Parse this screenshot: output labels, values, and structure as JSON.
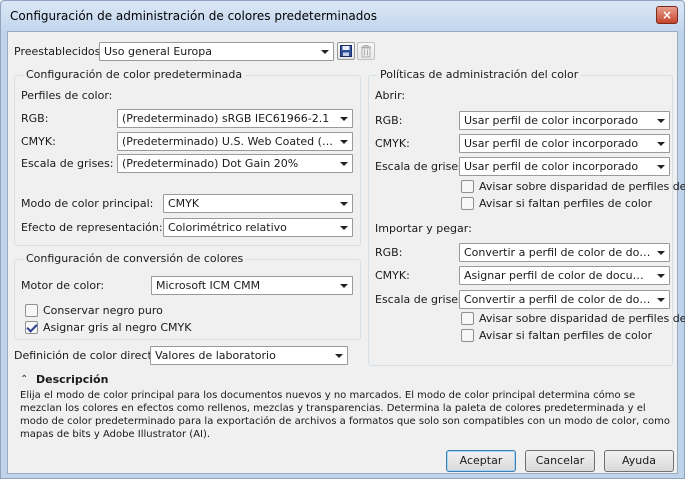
{
  "title": "Configuración de administración de colores predeterminados",
  "close_label": "×",
  "presets": {
    "label": "Preestablecidos:",
    "value": "Uso general Europa"
  },
  "default_settings": {
    "title": "Configuración de color predeterminada",
    "profiles_label": "Perfiles de color:",
    "rgb": {
      "label": "RGB:",
      "value": "(Predeterminado) sRGB IEC61966-2.1"
    },
    "cmyk": {
      "label": "CMYK:",
      "value": "(Predeterminado) U.S. Web Coated (SWOP)..."
    },
    "gray": {
      "label": "Escala de grises:",
      "value": "(Predeterminado) Dot Gain 20%"
    },
    "primary_mode": {
      "label": "Modo de color principal:",
      "value": "CMYK"
    },
    "rendering_intent": {
      "label": "Efecto de representación:",
      "value": "Colorimétrico relativo"
    }
  },
  "conversion": {
    "title": "Configuración de conversión de colores",
    "engine": {
      "label": "Motor de color:",
      "value": "Microsoft ICM CMM"
    },
    "preserve_black": {
      "label": "Conservar negro puro",
      "checked": false
    },
    "map_gray": {
      "label": "Asignar gris al negro CMYK",
      "checked": true
    }
  },
  "spot": {
    "label": "Definición de color directo:",
    "value": "Valores de laboratorio"
  },
  "policies": {
    "title": "Políticas de administración del color",
    "open": {
      "label": "Abrir:",
      "rgb": {
        "label": "RGB:",
        "value": "Usar perfil de color incorporado"
      },
      "cmyk": {
        "label": "CMYK:",
        "value": "Usar perfil de color incorporado"
      },
      "gray": {
        "label": "Escala de grises:",
        "value": "Usar perfil de color incorporado"
      },
      "warn_mismatch": {
        "label": "Avisar sobre disparidad de perfiles de color",
        "checked": false
      },
      "warn_missing": {
        "label": "Avisar si faltan perfiles de color",
        "checked": false
      }
    },
    "import": {
      "label": "Importar y pegar:",
      "rgb": {
        "label": "RGB:",
        "value": "Convertir a perfil de color de documento"
      },
      "cmyk": {
        "label": "CMYK:",
        "value": "Asignar perfil de color de documento"
      },
      "gray": {
        "label": "Escala de grises:",
        "value": "Convertir a perfil de color de documento"
      },
      "warn_mismatch": {
        "label": "Avisar sobre disparidad de perfiles de color",
        "checked": false
      },
      "warn_missing": {
        "label": "Avisar si faltan perfiles de color",
        "checked": false
      }
    }
  },
  "description": {
    "title": "Descripción",
    "text": "Elija el modo de color principal para los documentos nuevos y no marcados. El modo de color principal determina cómo se mezclan los colores en efectos como rellenos, mezclas y transparencias. Determina la paleta de colores predeterminada y el modo de color predeterminado para la exportación de archivos a formatos que solo son compatibles con un modo de color, como mapas de bits y Adobe Illustrator (AI)."
  },
  "buttons": {
    "ok": "Aceptar",
    "cancel": "Cancelar",
    "help": "Ayuda"
  }
}
